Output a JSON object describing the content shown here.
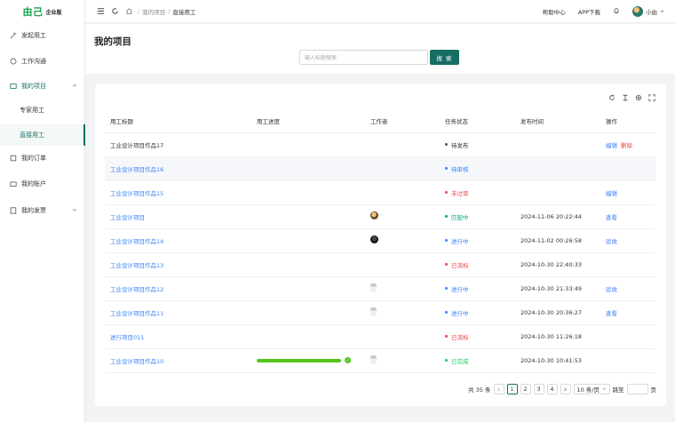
{
  "brand": {
    "mark": "由己",
    "edition": "企业版"
  },
  "sidebar": {
    "items": [
      {
        "label": "发起用工"
      },
      {
        "label": "工作沟通"
      },
      {
        "label": "我的项目"
      },
      {
        "label": "我的订单"
      },
      {
        "label": "我的账户"
      },
      {
        "label": "我的发票"
      }
    ],
    "subitems": [
      {
        "label": "专家用工"
      },
      {
        "label": "直接用工"
      }
    ]
  },
  "topbar": {
    "breadcrumb": [
      "我的项目",
      "直接用工"
    ],
    "help": "帮助中心",
    "app": "APP下载",
    "user": "小由"
  },
  "page": {
    "title": "我的项目",
    "search_placeholder": "输入标题搜索",
    "search_button": "搜 索"
  },
  "table": {
    "headers": [
      "用工标题",
      "用工进度",
      "工作者",
      "任务状态",
      "发布时间",
      "操作"
    ],
    "rows": [
      {
        "title": "工业设计项目作品17",
        "status": "待发布",
        "status_color": "#555555",
        "time": "",
        "ops": [
          "编辑",
          "删除"
        ],
        "link": false
      },
      {
        "title": "工业设计项目作品16",
        "status": "待审核",
        "status_color": "#3b82f6",
        "time": "",
        "ops": [],
        "link": true
      },
      {
        "title": "工业设计项目作品15",
        "status": "未过审",
        "status_color": "#ef4444",
        "time": "",
        "ops": [
          "编辑"
        ],
        "link": true
      },
      {
        "title": "工业设计项目",
        "status": "匹配中",
        "status_color": "#14a085",
        "time": "2024-11-06 20:22:44",
        "ops": [
          "查看"
        ],
        "link": true
      },
      {
        "title": "工业设计项目作品14",
        "status": "进行中",
        "status_color": "#3b82f6",
        "time": "2024-11-02 00:26:58",
        "ops": [
          "验收"
        ],
        "link": true
      },
      {
        "title": "工业设计项目作品13",
        "status": "已流标",
        "status_color": "#ef4444",
        "time": "2024-10-30 22:40:33",
        "ops": [],
        "link": true
      },
      {
        "title": "工业设计项目作品12",
        "status": "进行中",
        "status_color": "#3b82f6",
        "time": "2024-10-30 21:33:49",
        "ops": [
          "验收"
        ],
        "link": true
      },
      {
        "title": "工业设计项目作品11",
        "status": "进行中",
        "status_color": "#3b82f6",
        "time": "2024-10-30 20:36:27",
        "ops": [
          "查看"
        ],
        "link": true
      },
      {
        "title": "进行项目011",
        "status": "已流标",
        "status_color": "#ef4444",
        "time": "2024-10-30 11:26:18",
        "ops": [],
        "link": true
      },
      {
        "title": "工业设计项目作品10",
        "status": "已完成",
        "status_color": "#22c55e",
        "time": "2024-10-30 10:41:53",
        "ops": [],
        "link": true,
        "progress": 1.0
      }
    ]
  },
  "pagination": {
    "total": "共 35 条",
    "pages": [
      "1",
      "2",
      "3",
      "4"
    ],
    "page_size": "10 条/页",
    "jump": "跳至",
    "page_unit": "页"
  },
  "colors": {
    "accent": "#166e63",
    "link": "#3b82f6",
    "danger": "#ef4444",
    "success": "#52c41a"
  }
}
